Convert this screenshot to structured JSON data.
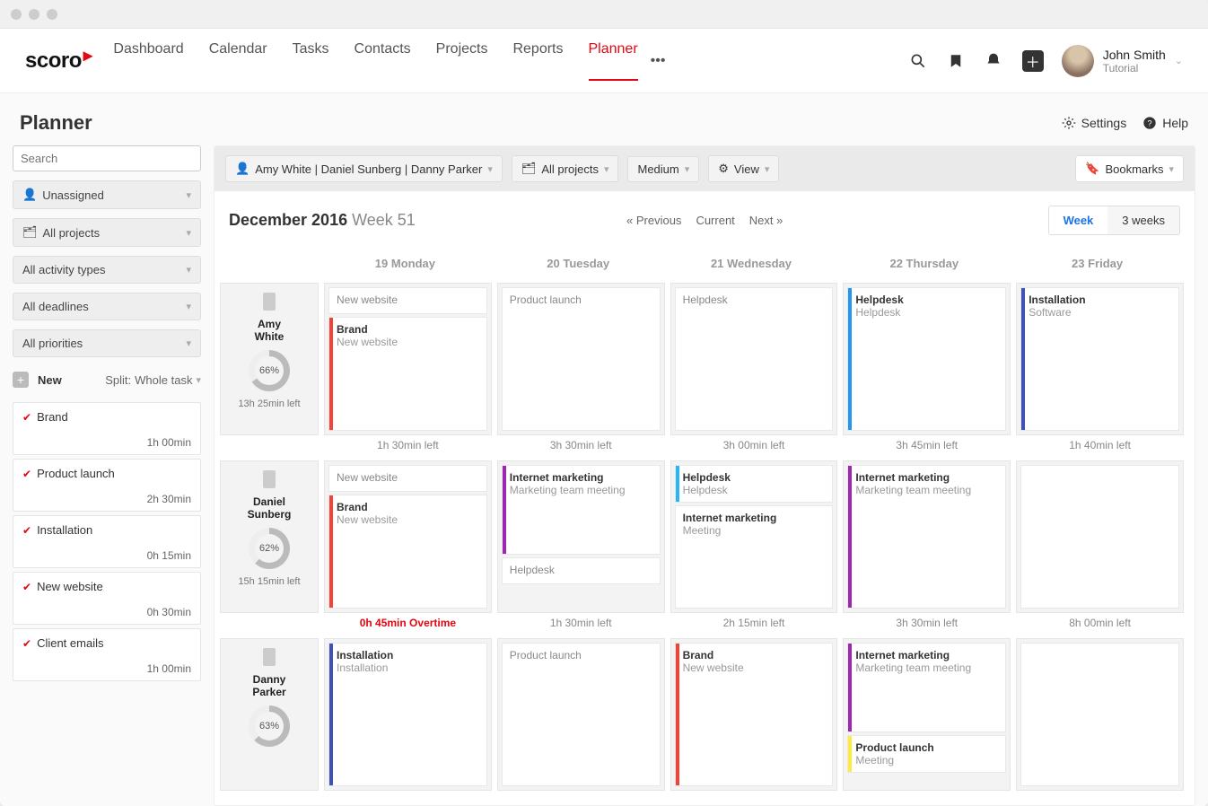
{
  "nav": {
    "logo": "scoro",
    "items": [
      "Dashboard",
      "Calendar",
      "Tasks",
      "Contacts",
      "Projects",
      "Reports",
      "Planner"
    ],
    "active": "Planner",
    "user_name": "John Smith",
    "user_sub": "Tutorial"
  },
  "page": {
    "title": "Planner",
    "settings": "Settings",
    "help": "Help"
  },
  "sidebar": {
    "search_placeholder": "Search",
    "filters": {
      "unassigned": "Unassigned",
      "all_projects": "All projects",
      "activity_types": "All activity types",
      "deadlines": "All deadlines",
      "priorities": "All priorities"
    },
    "new_label": "New",
    "split_label": "Split:",
    "split_value": "Whole task",
    "tasks": [
      {
        "name": "Brand",
        "dur": "1h 00min"
      },
      {
        "name": "Product launch",
        "dur": "2h 30min"
      },
      {
        "name": "Installation",
        "dur": "0h 15min"
      },
      {
        "name": "New website",
        "dur": "0h 30min"
      },
      {
        "name": "Client emails",
        "dur": "1h 00min"
      }
    ]
  },
  "toolbar": {
    "people": "Amy White | Daniel Sunberg | Danny Parker",
    "projects": "All projects",
    "size": "Medium",
    "view": "View",
    "bookmarks": "Bookmarks"
  },
  "range": {
    "month": "December 2016",
    "week": "Week 51",
    "prev": "« Previous",
    "current": "Current",
    "next": "Next »",
    "seg_week": "Week",
    "seg_3weeks": "3 weeks"
  },
  "days": [
    "19 Monday",
    "20 Tuesday",
    "21 Wednesday",
    "22 Thursday",
    "23 Friday"
  ],
  "rows": [
    {
      "name": "Amy White",
      "pct": "66%",
      "left": "13h 25min left",
      "cells": [
        [
          {
            "title": "New website",
            "sub": "",
            "color": ""
          },
          {
            "title": "Brand",
            "titleBold": true,
            "sub": "New website",
            "color": "#f44336",
            "fill": true
          }
        ],
        [
          {
            "title": "Product launch",
            "sub": "",
            "color": "",
            "fill": true
          }
        ],
        [
          {
            "title": "Helpdesk",
            "sub": "",
            "color": "",
            "fill": true
          }
        ],
        [
          {
            "title": "Helpdesk",
            "titleBold": true,
            "sub": "Helpdesk",
            "color": "#2196f3",
            "fill": true
          }
        ],
        [
          {
            "title": "Installation",
            "titleBold": true,
            "sub": "Software",
            "color": "#3f51b5",
            "fill": true
          }
        ]
      ],
      "leftRow": [
        "",
        "1h 30min left",
        "3h 30min left",
        "3h 00min left",
        "3h 45min left",
        "1h 40min left"
      ]
    },
    {
      "name": "Daniel Sunberg",
      "pct": "62%",
      "left": "15h 15min left",
      "cells": [
        [
          {
            "title": "New website",
            "sub": "",
            "color": ""
          },
          {
            "title": "Brand",
            "titleBold": true,
            "sub": "New website",
            "color": "#f44336",
            "fill": true
          }
        ],
        [
          {
            "title": "Internet marketing",
            "titleBold": true,
            "sub": "Marketing team meeting",
            "color": "#9c27b0",
            "tall": true
          },
          {
            "title": "Helpdesk",
            "sub": "",
            "color": ""
          }
        ],
        [
          {
            "title": "Helpdesk",
            "titleBold": true,
            "sub": "Helpdesk",
            "color": "#29b6f6"
          },
          {
            "title": "Internet marketing",
            "titleBold": true,
            "sub": "Meeting",
            "color": "",
            "fill": true
          }
        ],
        [
          {
            "title": "Internet marketing",
            "titleBold": true,
            "sub": "Marketing team meeting",
            "color": "#9c27b0",
            "fill": true
          }
        ],
        [
          {
            "title": "",
            "sub": "",
            "color": "",
            "fill": true
          }
        ]
      ],
      "leftRow": [
        "",
        "0h 45min Overtime",
        "1h 30min left",
        "2h 15min left",
        "3h 30min left",
        "8h 00min left"
      ],
      "over": [
        false,
        true,
        false,
        false,
        false,
        false
      ]
    },
    {
      "name": "Danny Parker",
      "pct": "63%",
      "left": "",
      "cells": [
        [
          {
            "title": "Installation",
            "titleBold": true,
            "sub": "Installation",
            "color": "#3f51b5",
            "fill": true
          }
        ],
        [
          {
            "title": "Product launch",
            "sub": "",
            "color": "",
            "fill": true
          }
        ],
        [
          {
            "title": "Brand",
            "titleBold": true,
            "sub": "New website",
            "color": "#f44336",
            "fill": true
          }
        ],
        [
          {
            "title": "Internet marketing",
            "titleBold": true,
            "sub": "Marketing team meeting",
            "color": "#9c27b0",
            "tall": true
          },
          {
            "title": "Product launch",
            "titleBold": true,
            "sub": "Meeting",
            "color": "#ffeb3b"
          }
        ],
        [
          {
            "title": "",
            "sub": "",
            "color": "",
            "fill": true
          }
        ]
      ],
      "leftRow": []
    }
  ]
}
